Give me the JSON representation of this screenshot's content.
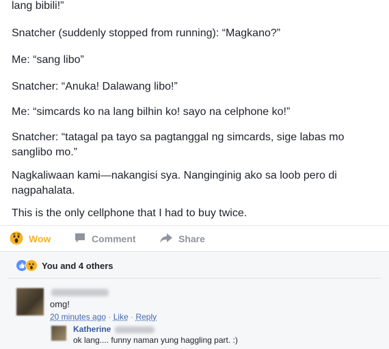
{
  "post": {
    "paragraphs": [
      "lang bibili!”",
      "Snatcher (suddenly stopped from running): “Magkano?”",
      "Me: “sang libo”",
      "Snatcher: “Anuka! Dalawang libo!”",
      "Me: “simcards ko na lang bilhin ko! sayo na celphone ko!”",
      "Snatcher: “tatagal pa tayo sa pagtanggal ng simcards, sige labas mo sanglibo mo.”",
      "Nagkaliwaan kami—nakangisi sya. Nanginginig ako sa loob pero di nagpahalata.",
      "This is the only cellphone that I had to buy twice."
    ]
  },
  "actions": {
    "wow": "Wow",
    "comment": "Comment",
    "share": "Share"
  },
  "reactions": {
    "summary": "You and 4 others"
  },
  "comments": [
    {
      "text": "omg!",
      "time": "20 minutes ago",
      "like": "Like",
      "reply": "Reply"
    },
    {
      "name": "Katherine",
      "text": "ok lang.... funny naman yung haggling part. :)"
    }
  ]
}
